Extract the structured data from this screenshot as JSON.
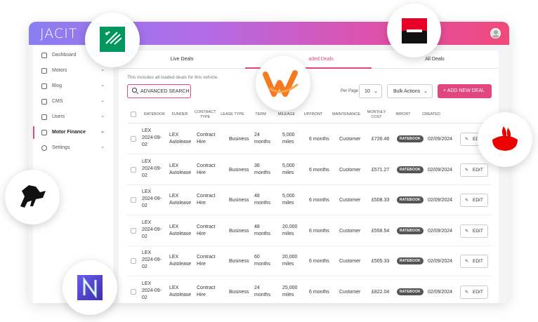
{
  "app": {
    "logo": "JACIT"
  },
  "sidebar": {
    "items": [
      {
        "label": "Dashboard",
        "icon": "home-icon",
        "chevron": ""
      },
      {
        "label": "Motors",
        "icon": "car-icon",
        "chevron": "⌄"
      },
      {
        "label": "Blog",
        "icon": "blog-icon",
        "chevron": "⌄"
      },
      {
        "label": "CMS",
        "icon": "cms-icon",
        "chevron": "⌄"
      },
      {
        "label": "Users",
        "icon": "users-icon",
        "chevron": "⌄"
      },
      {
        "label": "Motor Finance",
        "icon": "finance-icon",
        "chevron": "⌄",
        "active": true
      },
      {
        "label": "Settings",
        "icon": "gear-icon",
        "chevron": "⌄"
      }
    ]
  },
  "tabs": [
    "Live Deals",
    "aded Deals",
    "All Deals"
  ],
  "main": {
    "note": "This includes all loaded deals for this vehicle.",
    "search_label": "ADVANCED SEARCH",
    "per_page_label": "Per Page",
    "per_page_value": "10",
    "bulk_label": "Bulk Actions",
    "new_deal_label": "+ ADD NEW DEAL"
  },
  "table": {
    "headers": [
      "RATEBOOK",
      "FUNDER",
      "CONTRACT TYPE",
      "LEASE TYPE",
      "TERM",
      "MILEAGE",
      "UPFRONT",
      "MAINTENANCE",
      "MONTHLY COST",
      "IMPORT",
      "CREATED"
    ],
    "rows": [
      {
        "ratebook": "LEX 2024-09-02",
        "funder": "LEX Autolease",
        "contract": "Contract Hire",
        "lease": "Business",
        "term": "24 months",
        "mileage": "5,000 miles",
        "upfront": "6 months",
        "maintenance": "Customer",
        "cost": "£726.46",
        "import": "RATEBOOK",
        "created": "02/09/2024",
        "edit": "EDIT"
      },
      {
        "ratebook": "LEX 2024-09-02",
        "funder": "LEX Autolease",
        "contract": "Contract Hire",
        "lease": "Business",
        "term": "36 months",
        "mileage": "5,000 miles",
        "upfront": "6 months",
        "maintenance": "Customer",
        "cost": "£571.27",
        "import": "RATEBOOK",
        "created": "02/09/2024",
        "edit": "EDIT"
      },
      {
        "ratebook": "LEX 2024-09-02",
        "funder": "LEX Autolease",
        "contract": "Contract Hire",
        "lease": "Business",
        "term": "48 months",
        "mileage": "5,000 miles",
        "upfront": "6 months",
        "maintenance": "Customer",
        "cost": "£508.33",
        "import": "RATEBOOK",
        "created": "02/09/2024",
        "edit": "EDIT"
      },
      {
        "ratebook": "LEX 2024-09-02",
        "funder": "LEX Autolease",
        "contract": "Contract Hire",
        "lease": "Business",
        "term": "48 months",
        "mileage": "20,000 miles",
        "upfront": "6 months",
        "maintenance": "Customer",
        "cost": "£558.54",
        "import": "RATEBOOK",
        "created": "02/09/2024",
        "edit": "EDIT"
      },
      {
        "ratebook": "LEX 2024-09-02",
        "funder": "LEX Autolease",
        "contract": "Contract Hire",
        "lease": "Business",
        "term": "60 months",
        "mileage": "20,000 miles",
        "upfront": "6 months",
        "maintenance": "Customer",
        "cost": "£505.33",
        "import": "RATEBOOK",
        "created": "02/09/2024",
        "edit": "EDIT"
      },
      {
        "ratebook": "LEX 2024-09-02",
        "funder": "LEX Autolease",
        "contract": "Contract Hire",
        "lease": "Business",
        "term": "24 months",
        "mileage": "25,000 miles",
        "upfront": "6 months",
        "maintenance": "Customer",
        "cost": "£822.04",
        "import": "RATEBOOK",
        "created": "02/09/2024",
        "edit": "EDIT"
      }
    ]
  },
  "logos": [
    "bnp-paribas-logo",
    "societe-generale-logo",
    "santander-logo",
    "lloyds-logo",
    "n-logo",
    "w-logo"
  ],
  "colors": {
    "accent": "#e2467e",
    "gradient_start": "#8a7ff0",
    "gradient_end": "#f04a7c",
    "badge": "#545454"
  }
}
